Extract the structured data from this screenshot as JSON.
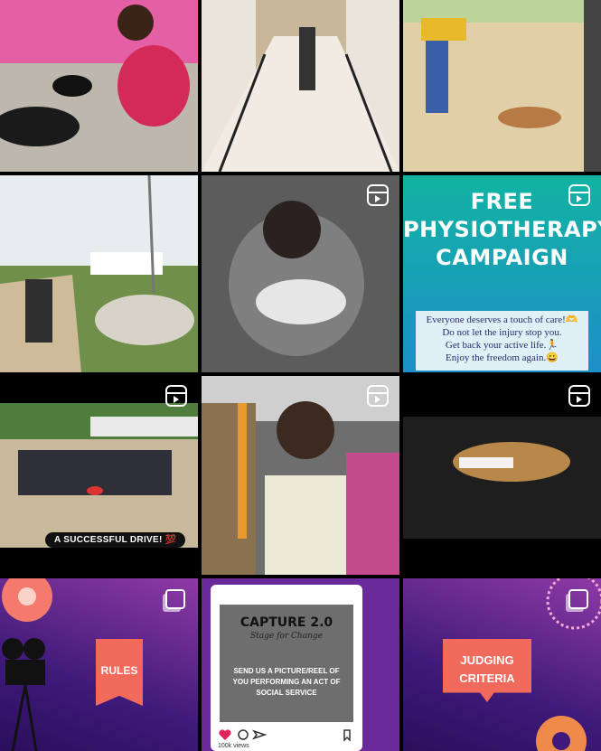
{
  "grid": {
    "posts": [
      {
        "id": "dog-feeding-photo",
        "type": "photo"
      },
      {
        "id": "corridor-cleaning-photo",
        "type": "photo"
      },
      {
        "id": "dog-park-photo",
        "type": "photo"
      },
      {
        "id": "cow-feeding-photo",
        "type": "photo"
      },
      {
        "id": "puppy-hold-reel",
        "type": "reel"
      },
      {
        "id": "physio-campaign-reel",
        "type": "reel"
      },
      {
        "id": "group-drive-reel",
        "type": "reel"
      },
      {
        "id": "market-reel",
        "type": "reel"
      },
      {
        "id": "night-dog-reel",
        "type": "reel"
      },
      {
        "id": "rules-carousel",
        "type": "carousel"
      },
      {
        "id": "capture-post",
        "type": "photo"
      },
      {
        "id": "judging-carousel",
        "type": "carousel"
      }
    ]
  },
  "campaign": {
    "title_lines": [
      "FREE",
      "PHYSIOTHERAPY",
      "CAMPAIGN"
    ],
    "box_lines": [
      "Everyone deserves a touch of care!🫶",
      "Do not let the injury stop you.",
      "Get back your active life.🏃",
      "Enjoy the freedom again.😀"
    ]
  },
  "drive_caption": "A SUCCESSFUL DRIVE! 💯",
  "rules_label": "RULES",
  "judging_label": [
    "JUDGING",
    "CRITERIA"
  ],
  "capture": {
    "title": "CAPTURE 2.0",
    "subtitle": "Stage for Change",
    "body_lines": [
      "SEND US A PICTURE/REEL OF",
      "YOU PERFORMING AN ACT OF",
      "SOCIAL SERVICE"
    ],
    "views": "100k views"
  },
  "colors": {
    "campaign_gradient_top": "#12b3a2",
    "campaign_gradient_bottom": "#1d8fc9",
    "purple": "#4a1a8c",
    "coral": "#f26a5b",
    "like_red": "#e0245e"
  }
}
